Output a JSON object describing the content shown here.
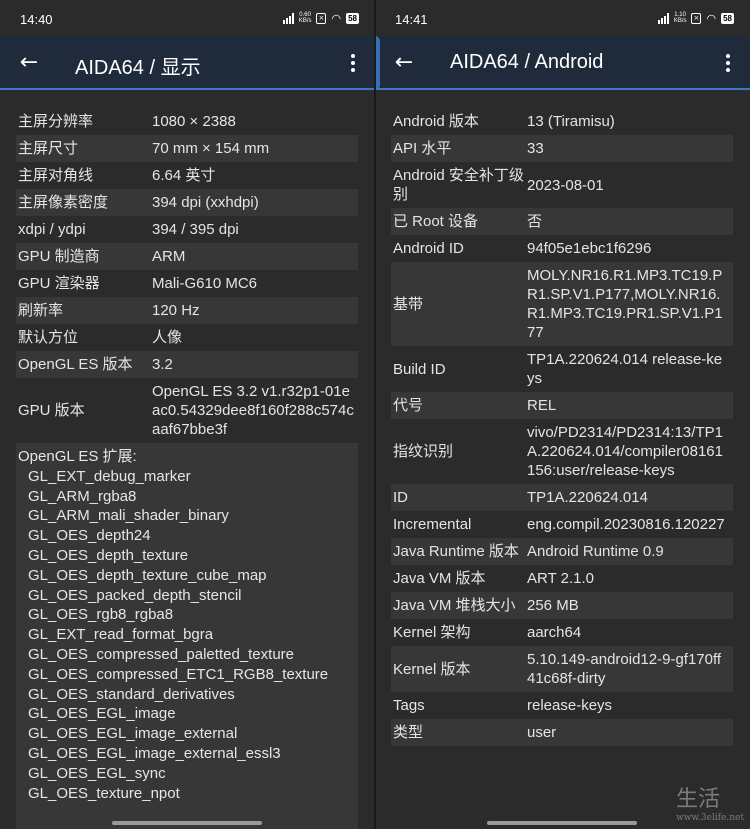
{
  "left": {
    "status": {
      "time": "14:40",
      "net_top": "0.60",
      "net_bottom": "KB/s",
      "battery": "58"
    },
    "title": "AIDA64  /  显示",
    "rows": [
      {
        "k": "主屏分辨率",
        "v": "1080 × 2388"
      },
      {
        "k": "主屏尺寸",
        "v": "70 mm × 154 mm"
      },
      {
        "k": "主屏对角线",
        "v": "6.64 英寸"
      },
      {
        "k": "主屏像素密度",
        "v": "394 dpi (xxhdpi)"
      },
      {
        "k": "xdpi / ydpi",
        "v": "394 / 395 dpi"
      },
      {
        "k": "GPU 制造商",
        "v": "ARM"
      },
      {
        "k": "GPU 渲染器",
        "v": "Mali-G610 MC6"
      },
      {
        "k": "刷新率",
        "v": "120 Hz"
      },
      {
        "k": "默认方位",
        "v": "人像"
      },
      {
        "k": "OpenGL ES 版本",
        "v": "3.2"
      },
      {
        "k": "GPU 版本",
        "v": "OpenGL ES 3.2 v1.r32p1-01eac0.54329dee8f160f288c574caaf67bbe3f"
      }
    ],
    "ext_header": "OpenGL ES 扩展:",
    "ext_items": [
      "GL_EXT_debug_marker",
      "GL_ARM_rgba8",
      "GL_ARM_mali_shader_binary",
      "GL_OES_depth24",
      "GL_OES_depth_texture",
      "GL_OES_depth_texture_cube_map",
      "GL_OES_packed_depth_stencil",
      "GL_OES_rgb8_rgba8",
      "GL_EXT_read_format_bgra",
      "GL_OES_compressed_paletted_texture",
      "GL_OES_compressed_ETC1_RGB8_texture",
      "GL_OES_standard_derivatives",
      "GL_OES_EGL_image",
      "GL_OES_EGL_image_external",
      "GL_OES_EGL_image_external_essl3",
      "GL_OES_EGL_sync",
      "GL_OES_texture_npot"
    ]
  },
  "right": {
    "status": {
      "time": "14:41",
      "net_top": "1.10",
      "net_bottom": "KB/s",
      "battery": "58"
    },
    "title": "AIDA64  /  Android",
    "rows": [
      {
        "k": "Android 版本",
        "v": "13 (Tiramisu)"
      },
      {
        "k": "API 水平",
        "v": "33"
      },
      {
        "k": "Android 安全补丁级别",
        "v": "2023-08-01"
      },
      {
        "k": "已 Root 设备",
        "v": "否"
      },
      {
        "k": "Android ID",
        "v": "94f05e1ebc1f6296"
      },
      {
        "k": "基带",
        "v": "MOLY.NR16.R1.MP3.TC19.PR1.SP.V1.P177,MOLY.NR16.R1.MP3.TC19.PR1.SP.V1.P177"
      },
      {
        "k": "Build ID",
        "v": "TP1A.220624.014 release-keys"
      },
      {
        "k": "代号",
        "v": "REL"
      },
      {
        "k": "指纹识别",
        "v": "vivo/PD2314/PD2314:13/TP1A.220624.014/compiler08161156:user/release-keys"
      },
      {
        "k": "ID",
        "v": "TP1A.220624.014"
      },
      {
        "k": "Incremental",
        "v": "eng.compil.20230816.120227"
      },
      {
        "k": "Java Runtime 版本",
        "v": "Android Runtime 0.9"
      },
      {
        "k": "Java VM 版本",
        "v": "ART 2.1.0"
      },
      {
        "k": "Java VM 堆栈大小",
        "v": "256 MB"
      },
      {
        "k": "Kernel 架构",
        "v": "aarch64"
      },
      {
        "k": "Kernel 版本",
        "v": "5.10.149-android12-9-gf170ff41c68f-dirty"
      },
      {
        "k": "Tags",
        "v": "release-keys"
      },
      {
        "k": "类型",
        "v": "user"
      }
    ]
  },
  "watermark": {
    "main": "生活",
    "sub": "www.3elife.net"
  },
  "colors": {
    "appbar": "#1f2a3a",
    "accent": "#3a78c4",
    "bg": "#2b2b2b",
    "row_alt": "#373737"
  },
  "icons": [
    "back-arrow-icon",
    "more-vert-icon",
    "signal-icon",
    "wifi-icon",
    "battery-icon"
  ]
}
